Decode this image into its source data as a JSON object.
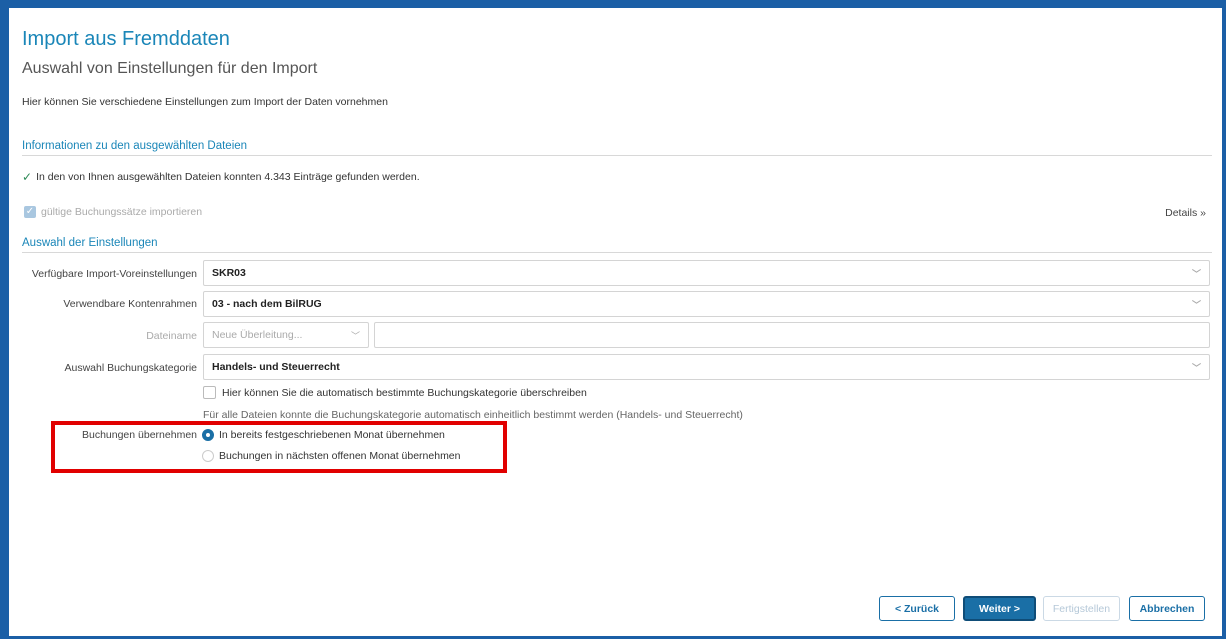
{
  "header": {
    "title": "Import aus Fremddaten",
    "subtitle": "Auswahl von Einstellungen für den Import",
    "description": "Hier können Sie verschiedene Einstellungen zum Import der Daten vornehmen"
  },
  "info_section": {
    "heading": "Informationen zu den ausgewählten Dateien",
    "status": "In den von Ihnen ausgewählten Dateien konnten 4.343 Einträge gefunden werden.",
    "import_checkbox": "gültige Buchungssätze importieren",
    "details_label": "Details"
  },
  "settings": {
    "heading": "Auswahl der Einstellungen",
    "preset_label": "Verfügbare Import-Voreinstellungen",
    "preset_value": "SKR03",
    "chart_label": "Verwendbare Kontenrahmen",
    "chart_value": "03 - nach dem BilRUG",
    "filename_label": "Dateiname",
    "filename_value": "Neue Überleitung...",
    "category_label": "Auswahl Buchungskategorie",
    "category_value": "Handels- und Steuerrecht",
    "override_label": "Hier können Sie die automatisch bestimmte Buchungskategorie überschreiben",
    "note": "Für alle Dateien konnte die Buchungskategorie automatisch einheitlich bestimmt werden (Handels- und Steuerrecht)",
    "bookings_label": "Buchungen übernehmen",
    "radio_options": [
      "In bereits festgeschriebenen Monat übernehmen",
      "Buchungen in nächsten offenen Monat übernehmen"
    ],
    "radio_selected_index": 0
  },
  "footer": {
    "back": "< Zurück",
    "next": "Weiter >",
    "finish": "Fertigstellen",
    "cancel": "Abbrechen"
  }
}
